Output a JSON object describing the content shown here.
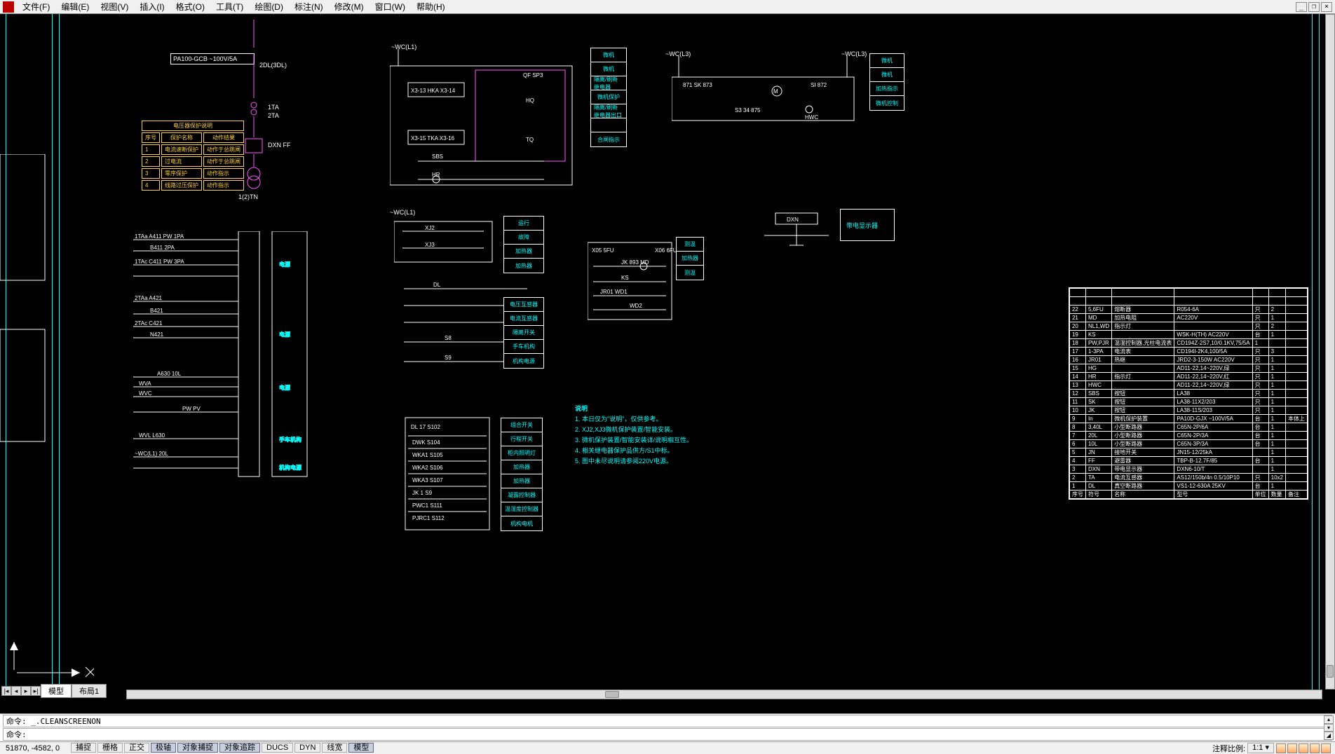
{
  "menu": {
    "items": [
      "文件(F)",
      "编辑(E)",
      "视图(V)",
      "插入(I)",
      "格式(O)",
      "工具(T)",
      "绘图(D)",
      "标注(N)",
      "修改(M)",
      "窗口(W)",
      "帮助(H)"
    ]
  },
  "win": {
    "min": "_",
    "restore": "❐",
    "close": "×"
  },
  "tabs": {
    "model": "模型",
    "layout1": "布局1"
  },
  "nav": {
    "first": "|◂",
    "prev": "◂",
    "next": "▸",
    "last": "▸|"
  },
  "cmd": {
    "label": "命令:",
    "history": "_.CLEANSCREENON",
    "prompt": ""
  },
  "status": {
    "coords": "51870, -4582, 0",
    "buttons": [
      "捕捉",
      "栅格",
      "正交",
      "极轴",
      "对象捕捉",
      "对象追踪",
      "DUCS",
      "DYN",
      "线宽",
      "模型"
    ],
    "pressed": [
      false,
      false,
      false,
      true,
      true,
      true,
      false,
      false,
      false,
      true
    ],
    "annoscale_label": "注释比例:",
    "annoscale": "1:1"
  },
  "drawing": {
    "relay_box": "PA100-GCB  ~100V/5A",
    "dl_label": "2DL(3DL)",
    "tn_label": "1(2)TN",
    "ta1": "1TA",
    "ta2": "2TA",
    "dxn_ff": "DXN  FF",
    "wc_l1": "~WC(L1)",
    "wc_l3": "~WC(L3)",
    "dxn": "DXN",
    "ytable": {
      "title": "电压器保护说明",
      "head": [
        "序号",
        "保护名称",
        "动作结果"
      ],
      "rows": [
        [
          "1",
          "电流速断保护",
          "动作于总跳闸"
        ],
        [
          "2",
          "过电流",
          "动作于总跳闸"
        ],
        [
          "3",
          "零序保护",
          "动作指示"
        ],
        [
          "4",
          "线路过压保护",
          "动作指示"
        ]
      ]
    },
    "legend1": [
      "微机",
      "微机",
      "隔离/刷新继电器",
      "微机保护",
      "隔离/刷新继电器出口",
      "",
      "合闸指示"
    ],
    "legend2": [
      "微机",
      "微机",
      "加热指示",
      "微机控制"
    ],
    "legend3": [
      "运行",
      "故障",
      "加热器",
      "加热器"
    ],
    "legend4": [
      "组合开关",
      "行程开关",
      "柜内照明灯",
      "加热器",
      "加热器",
      "凝露控制器",
      "温湿度控制器",
      "机构电机"
    ],
    "legend_mid": [
      "电压互感器",
      "电流互感器",
      "隔离开关",
      "手车机构",
      "机构电源"
    ],
    "notes_title": "说明",
    "notes": [
      "1. 本日仅为\"说明\"，仅供参考。",
      "2. XJ2,XJ3微机保护装置/智能安装。",
      "3. 微机保护装置/智能安装详/说明相互性。",
      "4. 相关继电器保护品供方/S1中标。",
      "5. 图中未尽说明请参阅220V电源。"
    ],
    "bom": {
      "header": [
        "序号",
        "符号",
        "名称",
        "型号",
        "单位",
        "数量",
        "备注"
      ],
      "rows": [
        [
          "22",
          "5,6FU",
          "熔断器",
          "R054-6A",
          "只",
          "2",
          ""
        ],
        [
          "21",
          "MD",
          "加热电阻",
          "AC220V",
          "只",
          "1",
          ""
        ],
        [
          "20",
          "NL1,WD",
          "指示灯",
          "",
          "只",
          "2",
          ""
        ],
        [
          "19",
          "KS",
          "",
          "WSK-H(TH)  AC220V",
          "台",
          "1",
          ""
        ],
        [
          "18",
          "PW,PJR",
          "温湿控制器,光柱电流表",
          "CD194Z-2S7,10/0.1KV,75/5A",
          "1",
          ""
        ],
        [
          "17",
          "1-3PA",
          "电流表",
          "CD194I-2K4,100/5A",
          "只",
          "3",
          ""
        ],
        [
          "16",
          "JR01",
          "热继",
          "JRD2-3-150W AC220V",
          "只",
          "1",
          ""
        ],
        [
          "15",
          "HG",
          "",
          "AD11-22,14~220V,绿",
          "只",
          "1",
          ""
        ],
        [
          "14",
          "HR",
          "指示灯",
          "AD11-22,14~220V,红",
          "只",
          "1",
          ""
        ],
        [
          "13",
          "HWC",
          "",
          "AD11-22,14~220V,绿",
          "只",
          "1",
          ""
        ],
        [
          "12",
          "SBS",
          "按钮",
          "LA38",
          "只",
          "1",
          ""
        ],
        [
          "11",
          "SK",
          "按钮",
          "LA38-11X2/203",
          "只",
          "1",
          ""
        ],
        [
          "10",
          "JK",
          "按钮",
          "LA38-11S/203",
          "只",
          "1",
          ""
        ],
        [
          "9",
          "In",
          "微机保护装置",
          "PA10D-GJX ~100V/5A",
          "台",
          "1",
          "本体上"
        ],
        [
          "8",
          "3,40L",
          "小型断路器",
          "C65N-2P/6A",
          "台",
          "1",
          ""
        ],
        [
          "7",
          "20L",
          "小型断路器",
          "C65N-2P/3A",
          "台",
          "1",
          ""
        ],
        [
          "6",
          "10L",
          "小型断路器",
          "C65N-3P/3A",
          "台",
          "1",
          ""
        ],
        [
          "5",
          "JN",
          "接地开关",
          "JN15-12/25kA",
          "",
          "1",
          ""
        ],
        [
          "4",
          "FF",
          "避雷器",
          "TBP-B-12.7F/85",
          "台",
          "1",
          ""
        ],
        [
          "3",
          "DXN",
          "带电显示器",
          "DXN6-10/T",
          "",
          "1",
          ""
        ],
        [
          "2",
          "TA",
          "电流互感器",
          "AS12/150b/4n  0.5/10P10",
          "只",
          "10x2",
          ""
        ],
        [
          "1",
          "DL",
          "真空断路器",
          "VS1-12-630A      25KV",
          "台",
          "1",
          ""
        ]
      ]
    }
  }
}
